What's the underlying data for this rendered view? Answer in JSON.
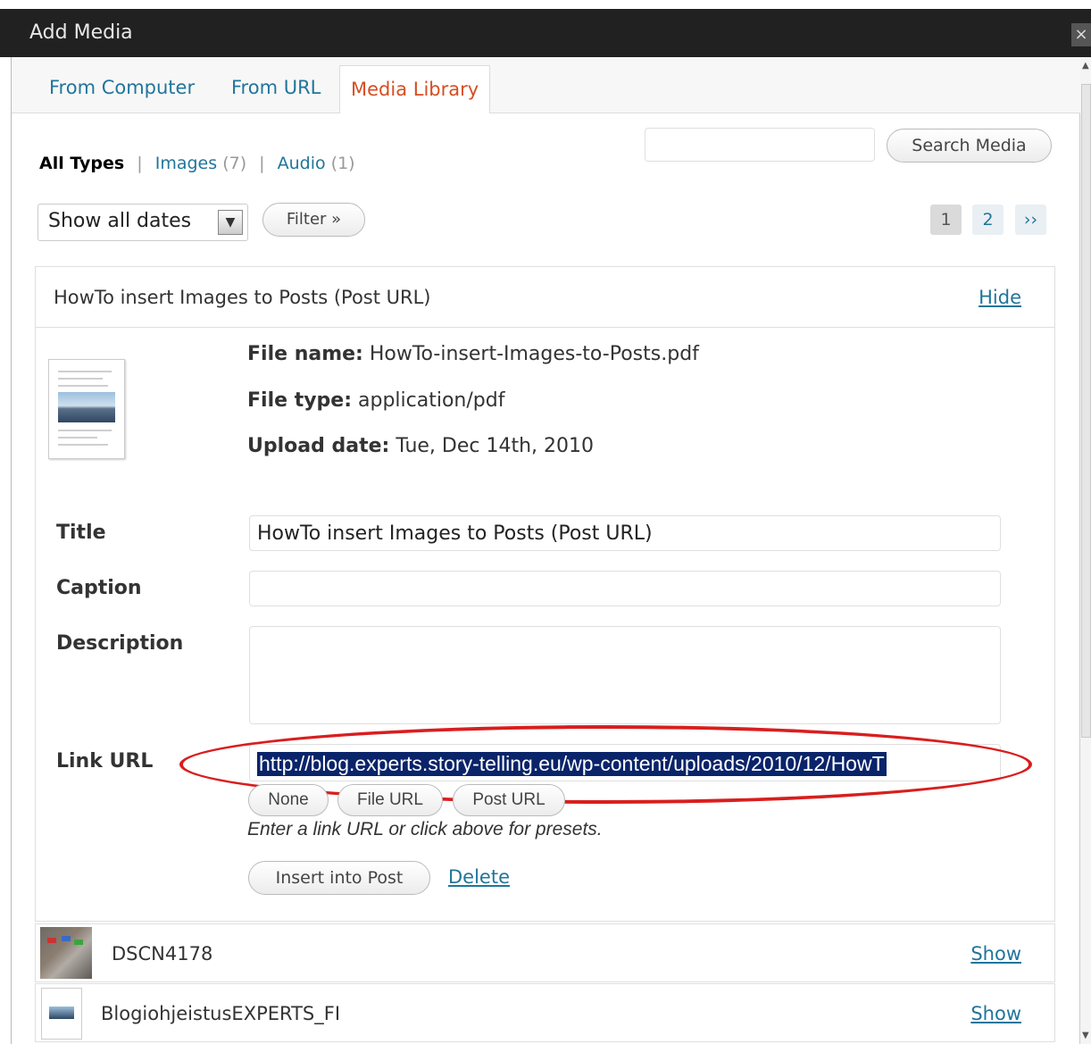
{
  "window": {
    "title": "Add Media",
    "close_glyph": "×"
  },
  "tabs": [
    {
      "label": "From Computer"
    },
    {
      "label": "From URL"
    },
    {
      "label": "Media Library",
      "active": true
    }
  ],
  "type_filter": {
    "current": "All Types",
    "sep": "|",
    "images": {
      "label": "Images",
      "count": "(7)"
    },
    "audio": {
      "label": "Audio",
      "count": "(1)"
    }
  },
  "search": {
    "button_label": "Search Media",
    "value": ""
  },
  "date_filter": {
    "selected": "Show all dates",
    "filter_button": "Filter »"
  },
  "pagination": {
    "pages": [
      "1",
      "2"
    ],
    "current": "1",
    "next": "››"
  },
  "item": {
    "header_title": "HowTo insert Images to Posts (Post URL)",
    "hide_label": "Hide",
    "file_name_label": "File name:",
    "file_name": "HowTo-insert-Images-to-Posts.pdf",
    "file_type_label": "File type:",
    "file_type": "application/pdf",
    "upload_date_label": "Upload date:",
    "upload_date": "Tue, Dec 14th, 2010",
    "fields": {
      "title_label": "Title",
      "title_value": "HowTo insert Images to Posts (Post URL)",
      "caption_label": "Caption",
      "caption_value": "",
      "description_label": "Description",
      "description_value": "",
      "link_url_label": "Link URL",
      "link_url_value": "http://blog.experts.story-telling.eu/wp-content/uploads/2010/12/HowT"
    },
    "link_presets": [
      "None",
      "File URL",
      "Post URL"
    ],
    "hint": "Enter a link URL or click above for presets.",
    "insert_button": "Insert into Post",
    "delete_link": "Delete"
  },
  "other_items": [
    {
      "name": "DSCN4178",
      "show_label": "Show"
    },
    {
      "name": "BlogiohjeistusEXPERTS_FI",
      "show_label": "Show"
    }
  ],
  "colors": {
    "link": "#21759b",
    "active_tab": "#d54e21",
    "annotation": "#d91e1e",
    "selection": "#0a246a"
  }
}
